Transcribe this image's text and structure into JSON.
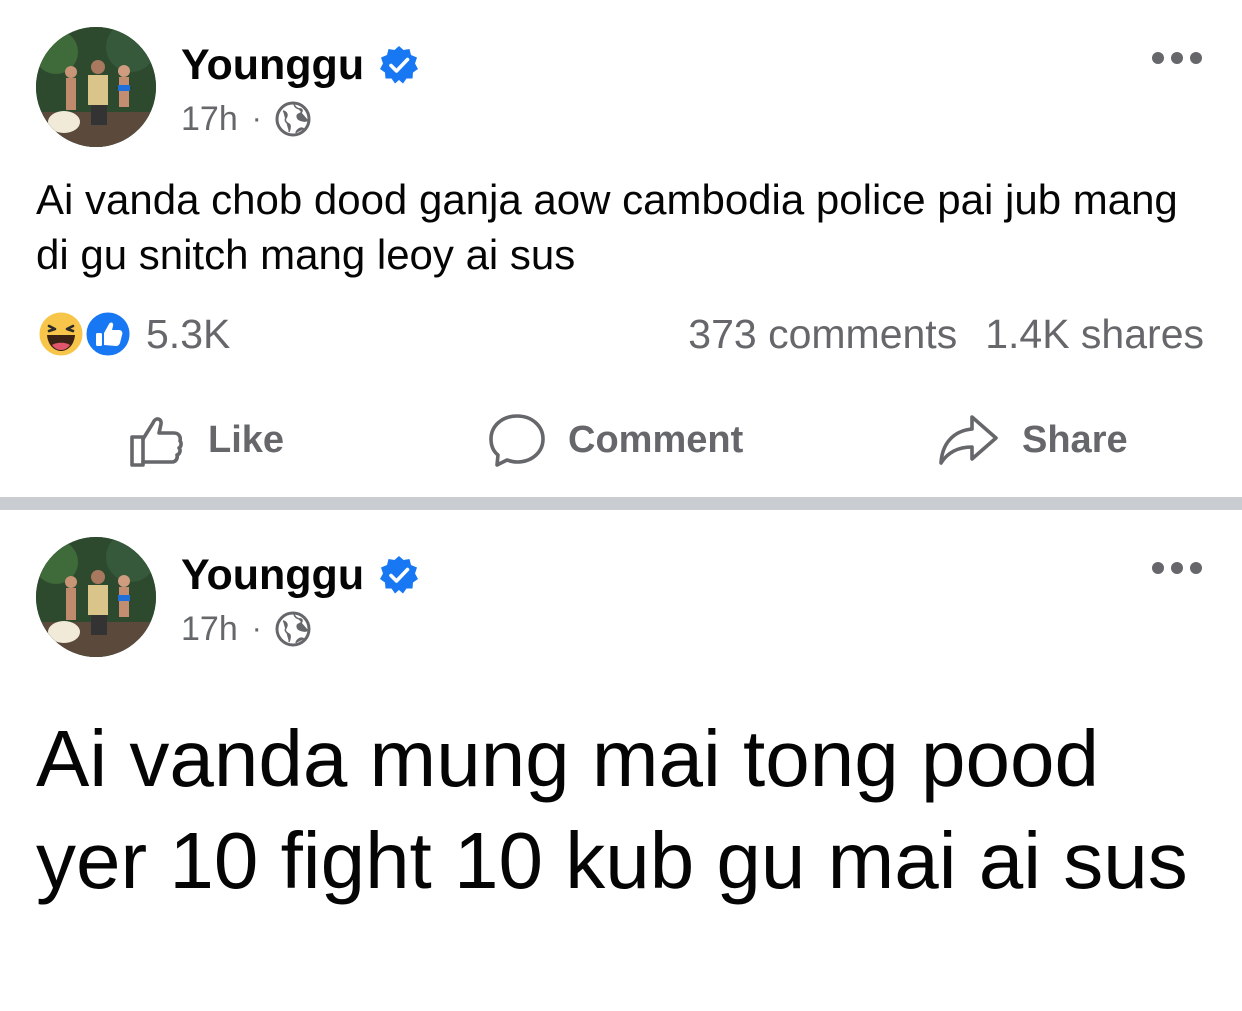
{
  "colors": {
    "text_primary": "#050505",
    "text_secondary": "#65676b",
    "verified_blue": "#1877f2",
    "divider": "#c9ccd1"
  },
  "posts": [
    {
      "author": "Younggu",
      "verified": true,
      "time": "17h",
      "separator": "·",
      "audience_icon": "globe-icon",
      "text": "Ai vanda chob dood ganja aow cambodia police pai jub mang di gu snitch mang leoy ai sus",
      "reactions": [
        "haha-reaction-icon",
        "like-reaction-icon"
      ],
      "reaction_count": "5.3K",
      "comments": "373 comments",
      "shares": "1.4K shares",
      "actions": {
        "like": "Like",
        "comment": "Comment",
        "share": "Share"
      }
    },
    {
      "author": "Younggu",
      "verified": true,
      "time": "17h",
      "separator": "·",
      "audience_icon": "globe-icon",
      "text": "Ai vanda mung mai tong pood yer 10 fight 10 kub gu mai ai sus"
    }
  ]
}
